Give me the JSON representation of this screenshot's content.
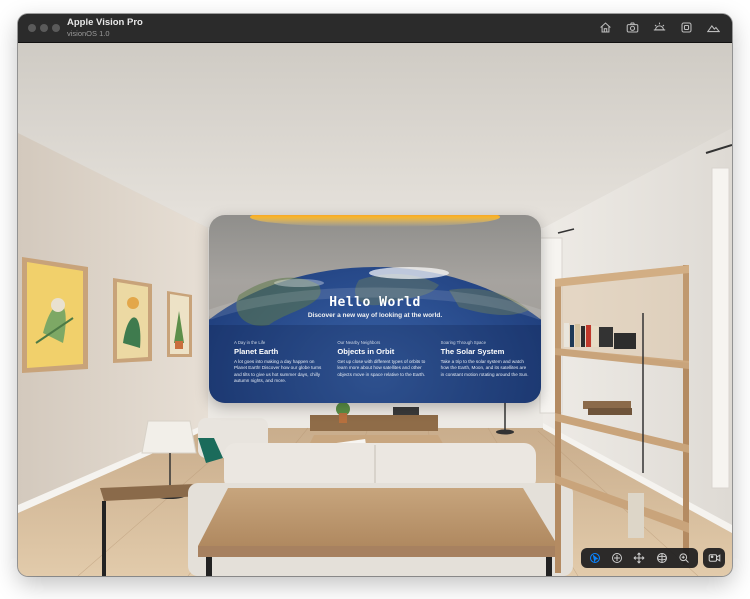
{
  "window": {
    "title": "Apple Vision Pro",
    "subtitle": "visionOS 1.0"
  },
  "titlebar_icons": [
    "home-icon",
    "camera-icon",
    "brightness-icon",
    "window-icon",
    "landscape-icon"
  ],
  "app_window": {
    "title": "Hello World",
    "subtitle": "Discover a new way of looking at the world.",
    "cards": [
      {
        "kicker": "A Day in the Life",
        "title": "Planet Earth",
        "body": "A lot goes into making a day happen on Planet Earth! Discover how our globe turns and tilts to give us hot summer days, chilly autumn nights, and more."
      },
      {
        "kicker": "Our Nearby Neighbors",
        "title": "Objects in Orbit",
        "body": "Get up close with different types of orbits to learn more about how satellites and other objects move in space relative to the Earth."
      },
      {
        "kicker": "Soaring Through Space",
        "title": "The Solar System",
        "body": "Take a trip to the solar system and watch how the Earth, Moon, and its satellites are in constant motion rotating around the Sun."
      }
    ]
  },
  "sim_toolbar": {
    "buttons": [
      "pointer-icon",
      "look-around-icon",
      "pan-icon",
      "orbit-icon",
      "zoom-icon"
    ],
    "active": "pointer-icon",
    "record": "record-icon"
  },
  "colors": {
    "titlebar": "#2b2b2b",
    "accent": "#0a84ff",
    "earth_ocean": "#1d3a78",
    "sun": "#f7a21c"
  }
}
